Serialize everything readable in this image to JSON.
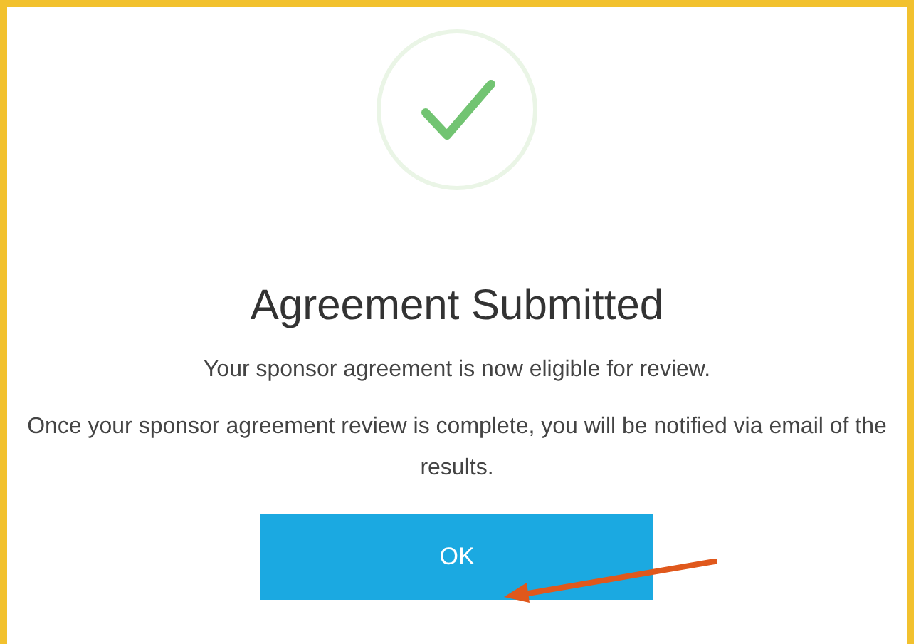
{
  "dialog": {
    "title": "Agreement Submitted",
    "messages": [
      "Your sponsor agreement is now eligible for review.",
      "Once your sponsor agreement review is complete, you will be notified via email of the results."
    ],
    "button": "OK"
  }
}
